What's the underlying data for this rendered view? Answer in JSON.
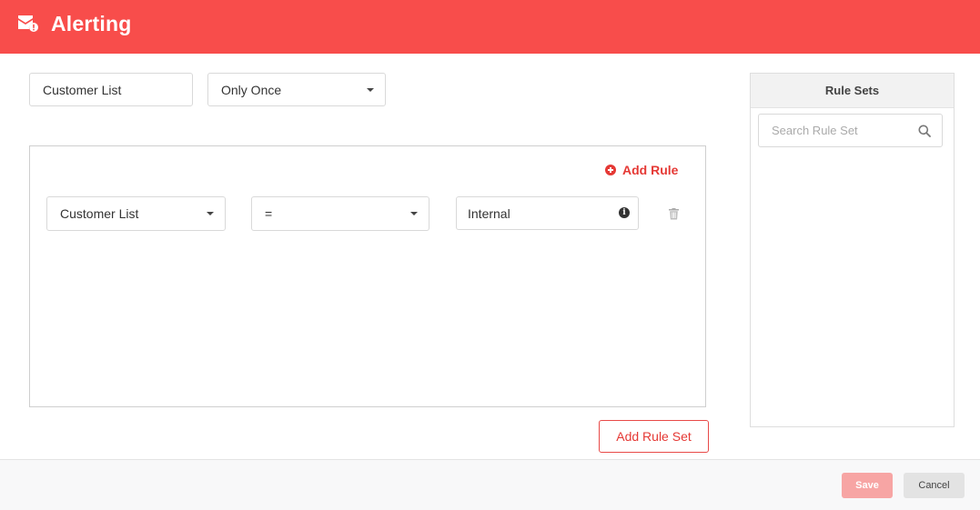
{
  "header": {
    "title": "Alerting",
    "icon": "mail-alert-icon"
  },
  "top_controls": {
    "name_value": "Customer List",
    "frequency_selected": "Only Once"
  },
  "rules": {
    "add_rule_label": "Add Rule",
    "rows": [
      {
        "field": "Customer List",
        "operator": "=",
        "value": "Internal"
      }
    ]
  },
  "add_rule_set_label": "Add Rule Set",
  "rule_sets_panel": {
    "title": "Rule Sets",
    "search_placeholder": "Search Rule Set"
  },
  "footer": {
    "save_label": "Save",
    "cancel_label": "Cancel"
  },
  "colors": {
    "brand": "#f84d4b",
    "accent_text": "#e53935",
    "save_disabled": "#f7a5a4"
  }
}
